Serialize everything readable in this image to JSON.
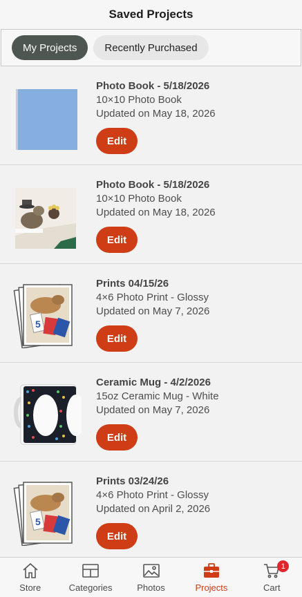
{
  "header": {
    "title": "Saved Projects"
  },
  "tabs": [
    {
      "label": "My Projects",
      "active": true
    },
    {
      "label": "Recently Purchased",
      "active": false
    }
  ],
  "projects": [
    {
      "title": "Photo Book - 5/18/2026",
      "subtitle": "10×10 Photo Book",
      "updated": "Updated on May 18, 2026",
      "edit_label": "Edit",
      "thumb": "blue-photo-book"
    },
    {
      "title": "Photo Book - 5/18/2026",
      "subtitle": "10×10 Photo Book",
      "updated": "Updated on May 18, 2026",
      "edit_label": "Edit",
      "thumb": "photo-book-image"
    },
    {
      "title": "Prints  04/15/26",
      "subtitle": "4×6 Photo Print - Glossy",
      "updated": "Updated on May 7, 2026",
      "edit_label": "Edit",
      "thumb": "photo-print-stack"
    },
    {
      "title": "Ceramic Mug - 4/2/2026",
      "subtitle": "15oz Ceramic Mug - White",
      "updated": "Updated on May 7, 2026",
      "edit_label": "Edit",
      "thumb": "ceramic-mug"
    },
    {
      "title": "Prints  03/24/26",
      "subtitle": "4×6 Photo Print - Glossy",
      "updated": "Updated on April 2, 2026",
      "edit_label": "Edit",
      "thumb": "photo-print-stack"
    }
  ],
  "nav": [
    {
      "label": "Store",
      "icon": "home-icon"
    },
    {
      "label": "Categories",
      "icon": "categories-icon"
    },
    {
      "label": "Photos",
      "icon": "photos-icon"
    },
    {
      "label": "Projects",
      "icon": "briefcase-icon",
      "active": true
    },
    {
      "label": "Cart",
      "icon": "cart-icon",
      "badge": "1"
    }
  ],
  "colors": {
    "accent": "#cf3d16",
    "active_tab": "#4d5650",
    "badge": "#e0262a"
  }
}
